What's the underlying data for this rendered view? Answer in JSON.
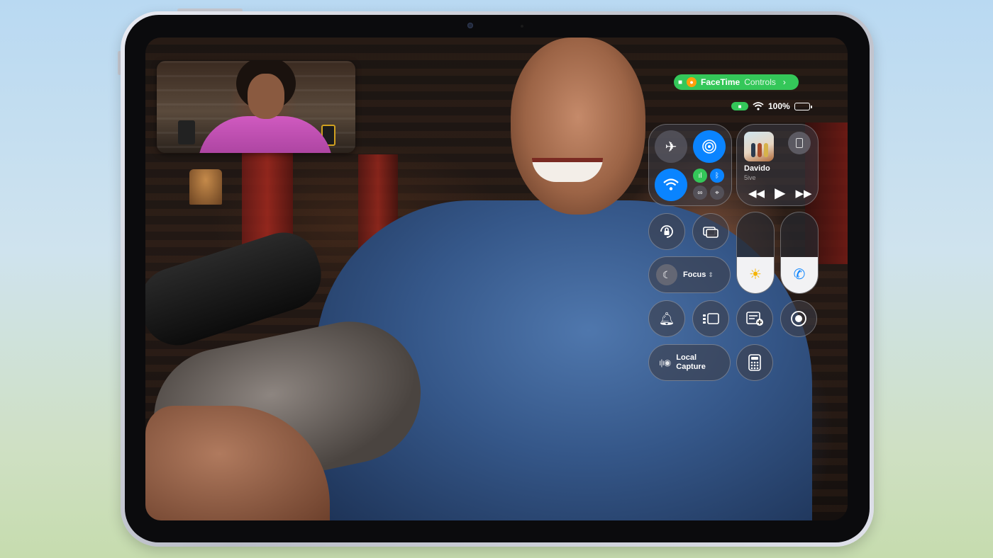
{
  "facetime_pill": {
    "title": "FaceTime",
    "subtitle": "Controls",
    "mic_icon": "mic-icon",
    "camera_icon": "video-camera-icon",
    "chevron_icon": "chevron-right-icon"
  },
  "status_bar": {
    "battery": "100%",
    "icons": [
      "video-camera-icon",
      "wifi-icon",
      "battery-icon"
    ]
  },
  "connectivity": {
    "airplane_icon": "airplane-icon",
    "airdrop_icon": "airdrop-icon",
    "wifi_icon": "wifi-icon",
    "cellular_icon": "cellular-icon",
    "bluetooth_icon": "bluetooth-icon",
    "hotspot_icon": "personal-hotspot-icon",
    "vpn_icon": "satellite-icon"
  },
  "now_playing": {
    "artist": "Davido",
    "song": "5ive",
    "controls": [
      "rewind-icon",
      "play-icon",
      "fast-forward-icon"
    ]
  },
  "toggles": {
    "rotation_lock_icon": "rotation-lock-icon",
    "screen_mirroring_icon": "screen-mirroring-icon",
    "focus_label": "Focus",
    "focus_icon": "moon-icon",
    "bell_icon": "bell-icon",
    "stage_manager_icon": "stage-manager-icon",
    "quick_note_icon": "quick-note-icon",
    "screen_record_icon": "screen-record-icon",
    "local_capture_label_1": "Local",
    "local_capture_label_2": "Capture",
    "calculator_icon": "calculator-icon"
  },
  "sliders": {
    "brightness": 0.45,
    "volume": 0.45,
    "brightness_icon": "sun-icon",
    "volume_icon": "phone-icon"
  },
  "colors": {
    "facetime_green": "#34c759",
    "accent_blue": "#0a84ff",
    "mic_orange": "#ff9f0a"
  }
}
